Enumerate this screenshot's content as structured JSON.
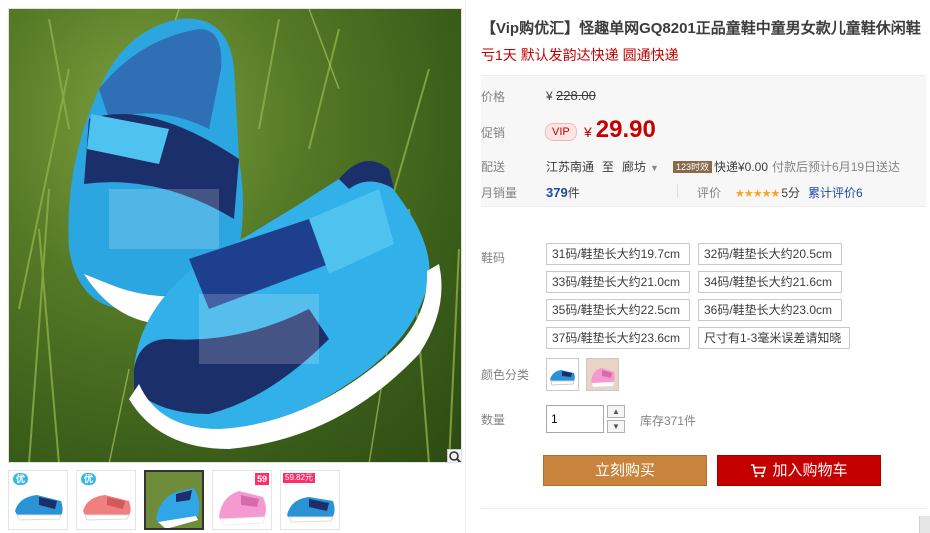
{
  "title": "【Vip购优汇】怪趣单网GQ8201正品童鞋中童男女款儿童鞋休闲鞋",
  "subtitle": "亏1天 默认发韵达快递 圆通快递",
  "price": {
    "label": "价格",
    "currency": "¥",
    "original": "228.00"
  },
  "promo": {
    "label": "促销",
    "badge": "VIP",
    "currency": "¥",
    "price": "29.90"
  },
  "shipping": {
    "label": "配送",
    "from": "江苏南通",
    "to_word": "至",
    "to": "廊坊",
    "tag": "123时效",
    "fee": "快递¥0.00",
    "eta": "付款后预计6月19日送达"
  },
  "sales": {
    "label": "月销量",
    "count": "379",
    "unit": "件",
    "rating_label": "评价",
    "stars": "★★★★★",
    "score": "5分",
    "review_text": "累计评价6"
  },
  "sizes": {
    "label": "鞋码",
    "options": [
      "31码/鞋垫长大约19.7cm",
      "32码/鞋垫长大约20.5cm",
      "33码/鞋垫长大约21.0cm",
      "34码/鞋垫长大约21.6cm",
      "35码/鞋垫长大约22.5cm",
      "36码/鞋垫长大约23.0cm",
      "37码/鞋垫长大约23.6cm",
      "尺寸有1-3毫米误差请知晓"
    ]
  },
  "colors": {
    "label": "颜色分类",
    "options": [
      "blue-shoe",
      "pink-shoe"
    ]
  },
  "quantity": {
    "label": "数量",
    "value": "1",
    "stock": "库存371件"
  },
  "buttons": {
    "buy": "立刻购买",
    "cart": "加入购物车"
  },
  "thumbnails": [
    {
      "tag": "优",
      "colors": [
        "#2a93d5",
        "#1a2f6a"
      ]
    },
    {
      "tag": "优",
      "colors": [
        "#f08080",
        "#d35a5a"
      ]
    },
    {
      "tag": "",
      "colors": [
        "#2fa7e6",
        "#1d2e6b"
      ]
    },
    {
      "tag": "",
      "badge": "59",
      "colors": [
        "#f59ad0",
        "#d66aac"
      ]
    },
    {
      "tag": "",
      "badge2": "59.82元",
      "colors": [
        "#2a93d5",
        "#1d2e6b"
      ]
    }
  ],
  "accent": {
    "price_red": "#c40000",
    "buy_orange": "#c8843d",
    "link_blue": "#1e4aa8"
  }
}
